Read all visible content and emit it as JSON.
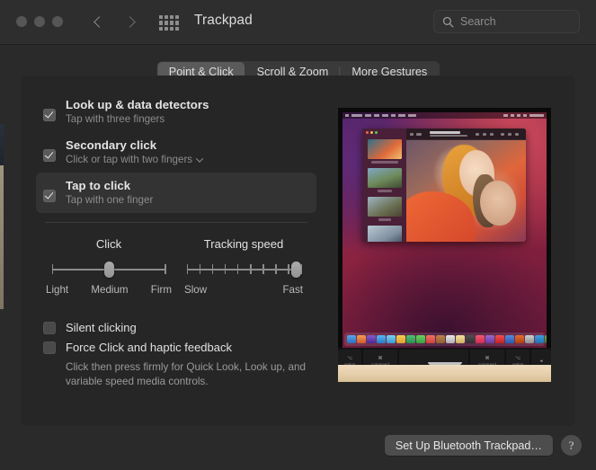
{
  "window": {
    "title": "Trackpad",
    "traffic_lights": [
      "close",
      "minimize",
      "zoom"
    ]
  },
  "toolbar": {
    "back_label": "‹",
    "forward_label": "›",
    "grid_icon": "show-all-icon",
    "search": {
      "placeholder": "Search",
      "value": "",
      "icon": "search-icon"
    }
  },
  "tabs": [
    {
      "label": "Point & Click",
      "selected": true
    },
    {
      "label": "Scroll & Zoom",
      "selected": false
    },
    {
      "label": "More Gestures",
      "selected": false
    }
  ],
  "options": [
    {
      "title": "Look up & data detectors",
      "subtitle": "Tap with three fingers",
      "checked": true,
      "highlighted": false,
      "has_popup": false
    },
    {
      "title": "Secondary click",
      "subtitle": "Click or tap with two fingers",
      "checked": true,
      "highlighted": false,
      "has_popup": true
    },
    {
      "title": "Tap to click",
      "subtitle": "Tap with one finger",
      "checked": true,
      "highlighted": true,
      "has_popup": false
    }
  ],
  "sliders": [
    {
      "name": "click",
      "label": "Click",
      "scale": [
        "Light",
        "Medium",
        "Firm"
      ],
      "value_percent": 50,
      "ticks": 0
    },
    {
      "name": "tracking-speed",
      "label": "Tracking speed",
      "scale": [
        "Slow",
        "Fast"
      ],
      "value_percent": 100,
      "ticks": 10
    }
  ],
  "bottom_options": [
    {
      "label": "Silent clicking",
      "checked": false
    },
    {
      "label": "Force Click and haptic feedback",
      "checked": false
    }
  ],
  "force_click_note": "Click then press firmly for Quick Look, Look up, and variable speed media controls.",
  "footer": {
    "setup_button": "Set Up Bluetooth Trackpad…",
    "help_button": "?"
  },
  "preview": {
    "name": "macbook-trackpad-photo",
    "description": "MacBook showing Photos app with two people, dock, keyboard and trackpad on a wooden desk"
  },
  "colors": {
    "window_bg": "#2a2a2a",
    "titlebar_bg": "#2e2e2e",
    "panel_bg": "#262626",
    "row_highlight": "#333333",
    "tab_selected": "#5a5a5a",
    "checkbox_fill": "#5a5a5a",
    "text_primary": "#e4e4e4",
    "text_secondary": "#8c8c8c",
    "button_bg": "#4d4d4d"
  }
}
